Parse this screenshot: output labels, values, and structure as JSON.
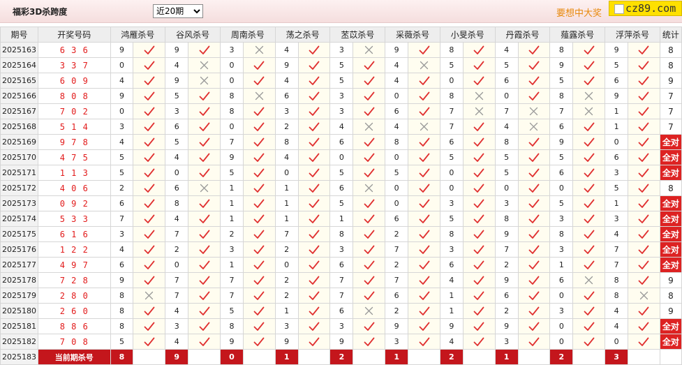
{
  "header": {
    "title": "福彩3D杀跨度",
    "period_selected": "近20期",
    "promo": "要想中大奖",
    "logo_text": "cz89.com"
  },
  "columns": {
    "period": "期号",
    "draw": "开奖号码",
    "experts": [
      "鸿雁杀号",
      "谷风杀号",
      "周南杀号",
      "荡之杀号",
      "苤苡杀号",
      "采薇杀号",
      "小旻杀号",
      "丹霞杀号",
      "薤露杀号",
      "浮萍杀号"
    ],
    "stats": "统计"
  },
  "rows": [
    {
      "period": "2025163",
      "draw": "6 3 6",
      "picks": [
        "9",
        "9",
        "3",
        "4",
        "3",
        "9",
        "8",
        "4",
        "8",
        "9"
      ],
      "hits": [
        1,
        1,
        0,
        1,
        0,
        1,
        1,
        1,
        1,
        1
      ],
      "stat": "8"
    },
    {
      "period": "2025164",
      "draw": "3 3 7",
      "picks": [
        "0",
        "4",
        "0",
        "9",
        "5",
        "4",
        "5",
        "5",
        "9",
        "5"
      ],
      "hits": [
        1,
        0,
        1,
        1,
        1,
        0,
        1,
        1,
        1,
        1
      ],
      "stat": "8"
    },
    {
      "period": "2025165",
      "draw": "6 0 9",
      "picks": [
        "4",
        "9",
        "0",
        "4",
        "5",
        "4",
        "0",
        "6",
        "5",
        "6"
      ],
      "hits": [
        1,
        0,
        1,
        1,
        1,
        1,
        1,
        1,
        1,
        1
      ],
      "stat": "9"
    },
    {
      "period": "2025166",
      "draw": "8 0 8",
      "picks": [
        "9",
        "5",
        "8",
        "6",
        "3",
        "0",
        "8",
        "0",
        "8",
        "9"
      ],
      "hits": [
        1,
        1,
        0,
        1,
        1,
        1,
        0,
        1,
        0,
        1
      ],
      "stat": "7"
    },
    {
      "period": "2025167",
      "draw": "7 0 2",
      "picks": [
        "0",
        "3",
        "8",
        "3",
        "3",
        "6",
        "7",
        "7",
        "7",
        "1"
      ],
      "hits": [
        1,
        1,
        1,
        1,
        1,
        1,
        0,
        0,
        0,
        1
      ],
      "stat": "7"
    },
    {
      "period": "2025168",
      "draw": "5 1 4",
      "picks": [
        "3",
        "6",
        "0",
        "2",
        "4",
        "4",
        "7",
        "4",
        "6",
        "1"
      ],
      "hits": [
        1,
        1,
        1,
        1,
        0,
        0,
        1,
        0,
        1,
        1
      ],
      "stat": "7"
    },
    {
      "period": "2025169",
      "draw": "9 7 8",
      "picks": [
        "4",
        "5",
        "7",
        "8",
        "6",
        "8",
        "6",
        "8",
        "9",
        "0"
      ],
      "hits": [
        1,
        1,
        1,
        1,
        1,
        1,
        1,
        1,
        1,
        1
      ],
      "stat": "全对"
    },
    {
      "period": "2025170",
      "draw": "4 7 5",
      "picks": [
        "5",
        "4",
        "9",
        "4",
        "0",
        "0",
        "5",
        "5",
        "5",
        "6"
      ],
      "hits": [
        1,
        1,
        1,
        1,
        1,
        1,
        1,
        1,
        1,
        1
      ],
      "stat": "全对"
    },
    {
      "period": "2025171",
      "draw": "1 1 3",
      "picks": [
        "5",
        "0",
        "5",
        "0",
        "5",
        "5",
        "0",
        "5",
        "6",
        "3"
      ],
      "hits": [
        1,
        1,
        1,
        1,
        1,
        1,
        1,
        1,
        1,
        1
      ],
      "stat": "全对"
    },
    {
      "period": "2025172",
      "draw": "4 0 6",
      "picks": [
        "2",
        "6",
        "1",
        "1",
        "6",
        "0",
        "0",
        "0",
        "0",
        "5"
      ],
      "hits": [
        1,
        0,
        1,
        1,
        0,
        1,
        1,
        1,
        1,
        1
      ],
      "stat": "8"
    },
    {
      "period": "2025173",
      "draw": "0 9 2",
      "picks": [
        "6",
        "8",
        "1",
        "1",
        "5",
        "0",
        "3",
        "3",
        "5",
        "1"
      ],
      "hits": [
        1,
        1,
        1,
        1,
        1,
        1,
        1,
        1,
        1,
        1
      ],
      "stat": "全对"
    },
    {
      "period": "2025174",
      "draw": "5 3 3",
      "picks": [
        "7",
        "4",
        "1",
        "1",
        "1",
        "6",
        "5",
        "8",
        "3",
        "3"
      ],
      "hits": [
        1,
        1,
        1,
        1,
        1,
        1,
        1,
        1,
        1,
        1
      ],
      "stat": "全对"
    },
    {
      "period": "2025175",
      "draw": "6 1 6",
      "picks": [
        "3",
        "7",
        "2",
        "7",
        "8",
        "2",
        "8",
        "9",
        "8",
        "4"
      ],
      "hits": [
        1,
        1,
        1,
        1,
        1,
        1,
        1,
        1,
        1,
        1
      ],
      "stat": "全对"
    },
    {
      "period": "2025176",
      "draw": "1 2 2",
      "picks": [
        "4",
        "2",
        "3",
        "2",
        "3",
        "7",
        "3",
        "7",
        "3",
        "7"
      ],
      "hits": [
        1,
        1,
        1,
        1,
        1,
        1,
        1,
        1,
        1,
        1
      ],
      "stat": "全对"
    },
    {
      "period": "2025177",
      "draw": "4 9 7",
      "picks": [
        "6",
        "0",
        "1",
        "0",
        "6",
        "2",
        "6",
        "2",
        "1",
        "7"
      ],
      "hits": [
        1,
        1,
        1,
        1,
        1,
        1,
        1,
        1,
        1,
        1
      ],
      "stat": "全对"
    },
    {
      "period": "2025178",
      "draw": "7 2 8",
      "picks": [
        "9",
        "7",
        "7",
        "2",
        "7",
        "7",
        "4",
        "9",
        "6",
        "8"
      ],
      "hits": [
        1,
        1,
        1,
        1,
        1,
        1,
        1,
        1,
        0,
        1
      ],
      "stat": "9"
    },
    {
      "period": "2025179",
      "draw": "2 8 0",
      "picks": [
        "8",
        "7",
        "7",
        "2",
        "7",
        "6",
        "1",
        "6",
        "0",
        "8"
      ],
      "hits": [
        0,
        1,
        1,
        1,
        1,
        1,
        1,
        1,
        1,
        0
      ],
      "stat": "8"
    },
    {
      "period": "2025180",
      "draw": "2 6 0",
      "picks": [
        "8",
        "4",
        "5",
        "1",
        "6",
        "2",
        "1",
        "2",
        "3",
        "4"
      ],
      "hits": [
        1,
        1,
        1,
        1,
        0,
        1,
        1,
        1,
        1,
        1
      ],
      "stat": "9"
    },
    {
      "period": "2025181",
      "draw": "8 8 6",
      "picks": [
        "8",
        "3",
        "8",
        "3",
        "3",
        "9",
        "9",
        "9",
        "0",
        "4"
      ],
      "hits": [
        1,
        1,
        1,
        1,
        1,
        1,
        1,
        1,
        1,
        1
      ],
      "stat": "全对"
    },
    {
      "period": "2025182",
      "draw": "7 0 8",
      "picks": [
        "5",
        "4",
        "9",
        "9",
        "9",
        "3",
        "4",
        "3",
        "0",
        "0"
      ],
      "hits": [
        1,
        1,
        1,
        1,
        1,
        1,
        1,
        1,
        1,
        1
      ],
      "stat": "全对"
    }
  ],
  "current": {
    "period": "2025183",
    "label": "当前期杀号",
    "picks": [
      "8",
      "9",
      "0",
      "1",
      "2",
      "1",
      "2",
      "1",
      "2",
      "3"
    ]
  },
  "colors": {
    "check": "#e03030",
    "cross": "#999999",
    "highlight": "#dd2222",
    "draw_text": "#e21b1b"
  }
}
